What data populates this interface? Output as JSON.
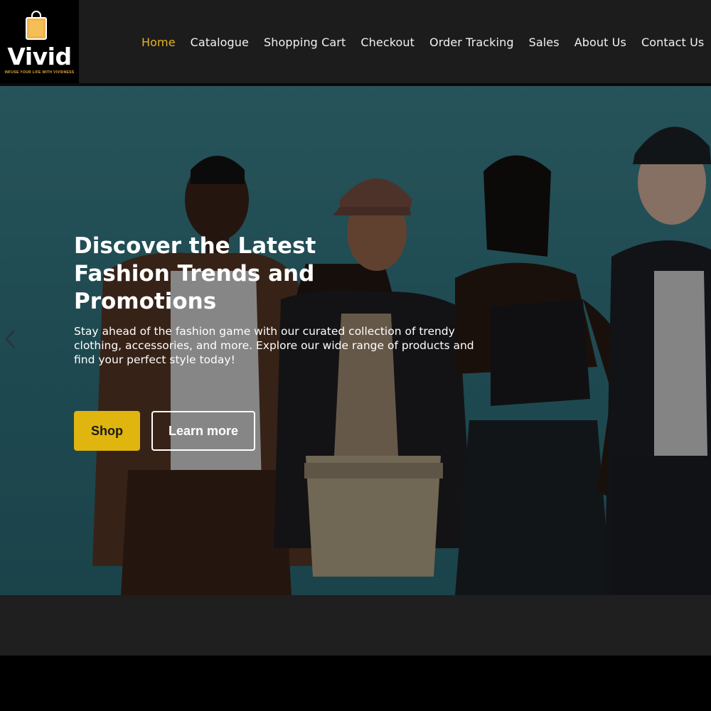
{
  "brand": {
    "name": "Vivid",
    "tagline": "INFUSE YOUR LIFE WITH VIVIDNESS",
    "logo_icon": "shopping-bag-icon",
    "accent_color": "#e5b521"
  },
  "nav": {
    "items": [
      {
        "label": "Home",
        "active": true
      },
      {
        "label": "Catalogue",
        "active": false
      },
      {
        "label": "Shopping Cart",
        "active": false
      },
      {
        "label": "Checkout",
        "active": false
      },
      {
        "label": "Order Tracking",
        "active": false
      },
      {
        "label": "Sales",
        "active": false
      },
      {
        "label": "About Us",
        "active": false
      },
      {
        "label": "Contact Us",
        "active": false
      }
    ]
  },
  "hero": {
    "title": "Discover the Latest Fashion Trends and Promotions",
    "subtitle": "Stay ahead of the fashion game with our curated collection of trendy clothing, accessories, and more. Explore our wide range of products and find your perfect style today!",
    "primary_button": "Shop",
    "secondary_button": "Learn more",
    "primary_color": "#dfb50e",
    "prev_icon": "chevron-left-icon"
  }
}
